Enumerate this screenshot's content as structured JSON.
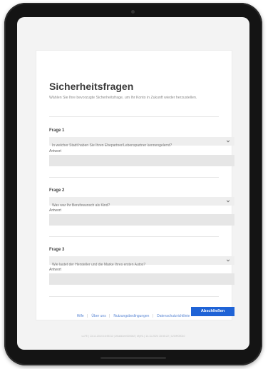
{
  "page": {
    "title": "Sicherheitsfragen",
    "subtitle": "Wählen Sie Ihre bevorzugte Sicherheitsfrage, um Ihr Konto in Zukunft wieder herzustellen."
  },
  "questions": [
    {
      "label": "Frage 1",
      "selected": "In welcher Stadt haben Sie Ihren Ehepartner/Lebenspartner kennengelernt?",
      "answer_label": "Antwort",
      "answer_value": ""
    },
    {
      "label": "Frage 2",
      "selected": "Was war Ihr Berufswunsch als Kind?",
      "answer_label": "Antwort",
      "answer_value": ""
    },
    {
      "label": "Frage 3",
      "selected": "Wie lautet der Hersteller und die Marke Ihres ersten Autos?",
      "answer_label": "Antwort",
      "answer_value": ""
    }
  ],
  "actions": {
    "submit_label": "Abschließen"
  },
  "footer": {
    "links": [
      "Hilfe",
      "Über uns",
      "Nutzungsbedingungen",
      "Datenschutzrichtlinie"
    ],
    "meta": "ui-FE | 13.11.2024 16:55:32 | #build3ee000082 | MyHL | 13.11.2024 15:55:22 | 120/R00010"
  },
  "colors": {
    "accent": "#1f63d6",
    "link": "#5b87d4"
  },
  "icons": {
    "select_arrow": "chevron-down-icon"
  }
}
